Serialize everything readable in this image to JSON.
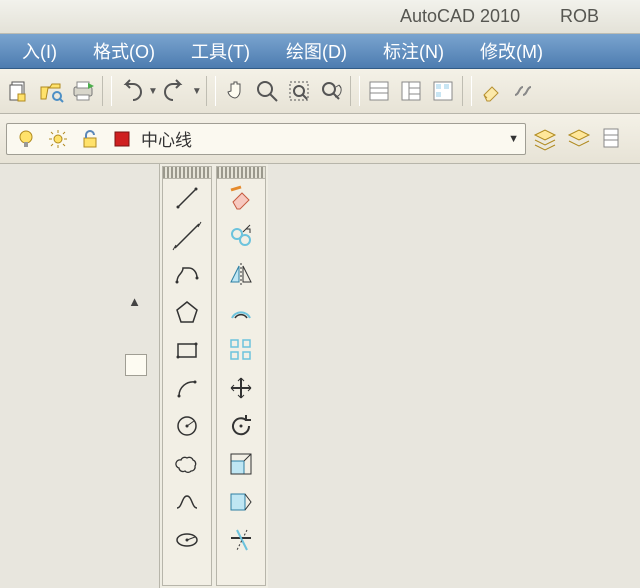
{
  "title": {
    "app": "AutoCAD 2010",
    "doc": "ROB"
  },
  "menu": {
    "insert": "入(I)",
    "format": "格式(O)",
    "tools": "工具(T)",
    "draw": "绘图(D)",
    "dim": "标注(N)",
    "modify": "修改(M)"
  },
  "layer": {
    "current": "中心线"
  },
  "colors": {
    "menubg": "#5a87b8",
    "red": "#cf2020",
    "yellow": "#f4c22b",
    "cyan": "#6cc3dd",
    "orange": "#e58a2c"
  }
}
